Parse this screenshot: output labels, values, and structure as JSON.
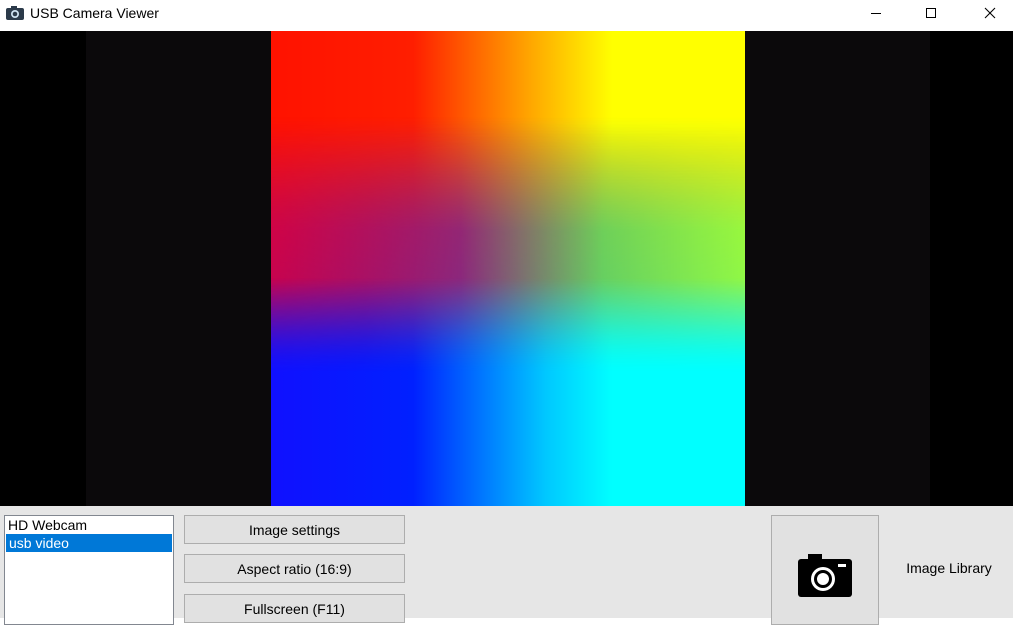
{
  "window": {
    "title": "USB Camera Viewer",
    "app_icon": "camera-icon",
    "controls": [
      "minimize-icon",
      "maximize-icon",
      "close-icon"
    ]
  },
  "video": {
    "background_color": "#000000",
    "letterbox_color": "#0b090b"
  },
  "devices": {
    "items": [
      {
        "label": "HD Webcam",
        "selected": false
      },
      {
        "label": "usb video",
        "selected": true
      }
    ],
    "selection_color": "#0078d7"
  },
  "buttons": {
    "image_settings": "Image settings",
    "aspect_ratio": "Aspect ratio (16:9)",
    "fullscreen": "Fullscreen (F11)"
  },
  "snapshot": {
    "icon": "camera-icon"
  },
  "library": {
    "label": "Image Library"
  }
}
